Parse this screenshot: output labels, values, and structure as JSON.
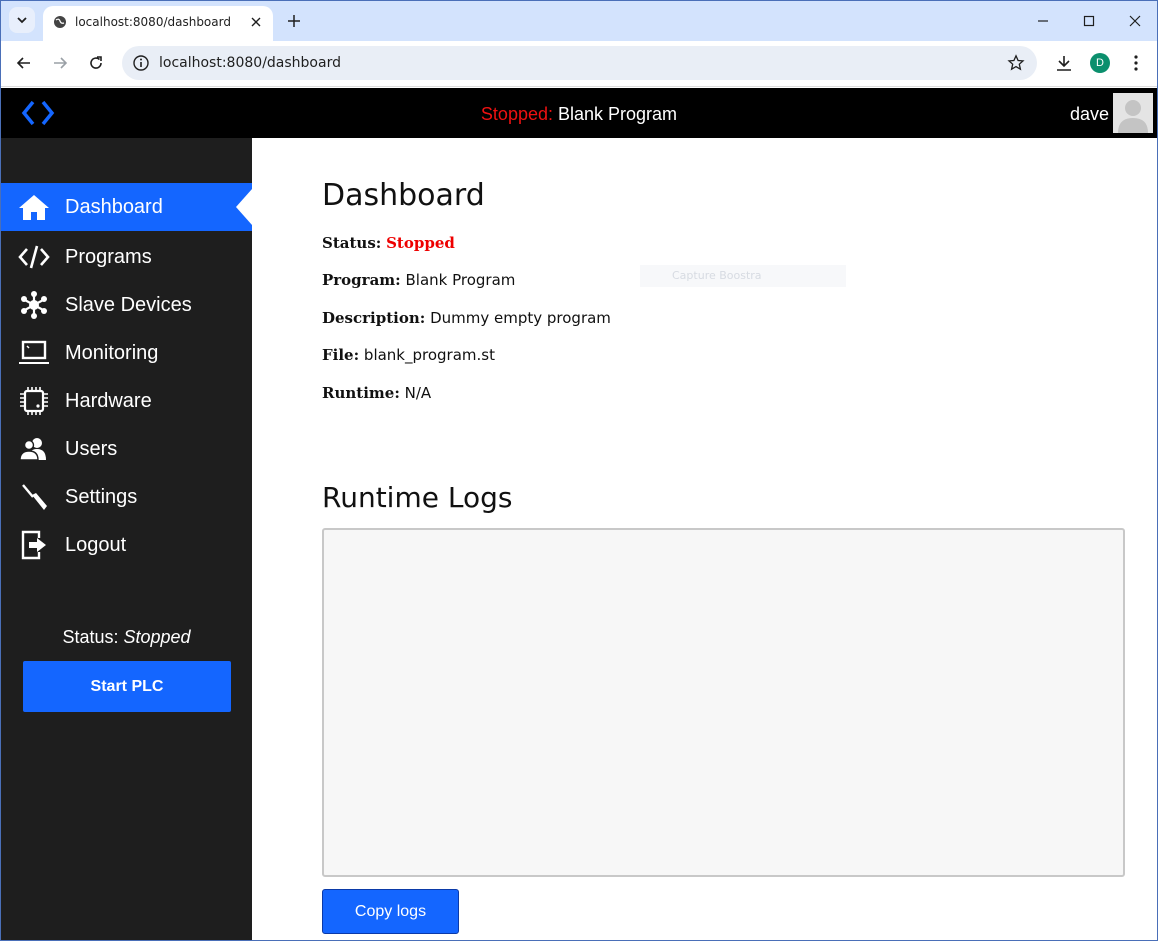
{
  "browser": {
    "tab_title": "localhost:8080/dashboard",
    "url": "localhost:8080/dashboard",
    "profile_initial": "D"
  },
  "header": {
    "status_word": "Stopped:",
    "program_name": "Blank Program",
    "username": "dave"
  },
  "sidebar": {
    "items": [
      {
        "label": "Dashboard",
        "icon": "home-icon"
      },
      {
        "label": "Programs",
        "icon": "code-icon"
      },
      {
        "label": "Slave Devices",
        "icon": "network-icon"
      },
      {
        "label": "Monitoring",
        "icon": "laptop-icon"
      },
      {
        "label": "Hardware",
        "icon": "chip-icon"
      },
      {
        "label": "Users",
        "icon": "users-icon"
      },
      {
        "label": "Settings",
        "icon": "screwdriver-icon"
      },
      {
        "label": "Logout",
        "icon": "logout-icon"
      }
    ],
    "status_label": "Status:",
    "status_value": "Stopped",
    "start_button": "Start PLC"
  },
  "main": {
    "title": "Dashboard",
    "status_label": "Status:",
    "status_value": "Stopped",
    "program_label": "Program:",
    "program_value": "Blank Program",
    "description_label": "Description:",
    "description_value": "Dummy empty program",
    "file_label": "File:",
    "file_value": "blank_program.st",
    "runtime_label": "Runtime:",
    "runtime_value": "N/A",
    "logs_title": "Runtime Logs",
    "logs_text": "",
    "copy_button": "Copy logs",
    "ghost_text": "Capture Boostra"
  },
  "colors": {
    "accent": "#1466ff",
    "stopped": "#e11111",
    "sidebar_bg": "#1e1e1e"
  }
}
